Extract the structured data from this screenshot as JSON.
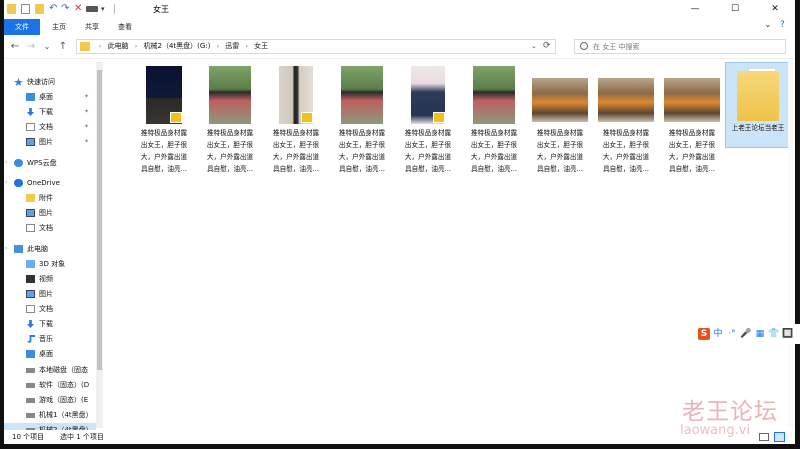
{
  "window": {
    "title": "女王",
    "controls": {
      "minimize": "—",
      "maximize": "☐",
      "close": "✕"
    }
  },
  "ribbon": {
    "tabs": [
      "文件",
      "主页",
      "共享",
      "查看"
    ],
    "active_tab": "文件",
    "accent_color": "#1a73e8"
  },
  "nav": {
    "back_icon": "←",
    "forward_icon": "→",
    "recent_icon": "⌄",
    "up_icon": "↑",
    "breadcrumb": [
      "此电脑",
      "机械2（4t黑盘）(G:)",
      "迅雷",
      "女王"
    ],
    "refresh_icon": "⟳",
    "search_placeholder": "在 女王 中搜索"
  },
  "sidebar": {
    "items": [
      {
        "label": "快速访问",
        "icon": "star-icon",
        "pinned": false
      },
      {
        "label": "桌面",
        "icon": "desktop-icon",
        "pinned": true
      },
      {
        "label": "下载",
        "icon": "download-icon",
        "pinned": true
      },
      {
        "label": "文档",
        "icon": "document-icon",
        "pinned": true
      },
      {
        "label": "图片",
        "icon": "pictures-icon",
        "pinned": true
      },
      {
        "label": "WPS云盘",
        "icon": "cloud-icon",
        "pinned": false
      },
      {
        "label": "OneDrive",
        "icon": "onedrive-icon",
        "pinned": false
      },
      {
        "label": "附件",
        "icon": "folder-icon",
        "pinned": false
      },
      {
        "label": "图片",
        "icon": "pictures-icon",
        "pinned": false
      },
      {
        "label": "文档",
        "icon": "document-icon",
        "pinned": false
      },
      {
        "label": "此电脑",
        "icon": "computer-icon",
        "pinned": false
      },
      {
        "label": "3D 对象",
        "icon": "cube-icon",
        "pinned": false
      },
      {
        "label": "视频",
        "icon": "video-icon",
        "pinned": false
      },
      {
        "label": "图片",
        "icon": "pictures-icon",
        "pinned": false
      },
      {
        "label": "文档",
        "icon": "document-icon",
        "pinned": false
      },
      {
        "label": "下载",
        "icon": "download-icon",
        "pinned": false
      },
      {
        "label": "音乐",
        "icon": "music-icon",
        "pinned": false
      },
      {
        "label": "桌面",
        "icon": "desktop-icon",
        "pinned": false
      },
      {
        "label": "本地磁盘（固态",
        "icon": "drive-icon",
        "pinned": false
      },
      {
        "label": "软件（固态）(D",
        "icon": "drive-icon",
        "pinned": false
      },
      {
        "label": "游戏（固态）(E",
        "icon": "drive-icon",
        "pinned": false
      },
      {
        "label": "机械1（4t黑盘）",
        "icon": "drive-icon",
        "pinned": false
      },
      {
        "label": "机械2（4t黑盘）",
        "icon": "drive-icon",
        "pinned": false,
        "selected": true
      }
    ]
  },
  "files": {
    "caption_line1": "推特极品身材露",
    "caption_line2": "出女王，胆子很",
    "caption_line3": "大，户外露出道",
    "caption_line4": "具自慰，油亮...",
    "items": [
      {
        "type": "video",
        "scene": "night"
      },
      {
        "type": "image",
        "scene": "garden"
      },
      {
        "type": "video",
        "scene": "room"
      },
      {
        "type": "image",
        "scene": "garden"
      },
      {
        "type": "video",
        "scene": "room-jeans"
      },
      {
        "type": "image",
        "scene": "garden"
      },
      {
        "type": "image",
        "scene": "cafe"
      },
      {
        "type": "image",
        "scene": "cafe"
      },
      {
        "type": "image",
        "scene": "cafe"
      }
    ],
    "folder": {
      "label": "上老王论坛当老王",
      "selected": true
    }
  },
  "status": {
    "count": "10 个项目",
    "selection": "选中 1 个项目"
  },
  "watermark": {
    "text": "老王论坛",
    "domain": "laowang.vi"
  },
  "ime_toolbar": {
    "items": [
      "S",
      "中",
      "·°",
      "🎤",
      "▦",
      "👕",
      "🔲"
    ]
  }
}
